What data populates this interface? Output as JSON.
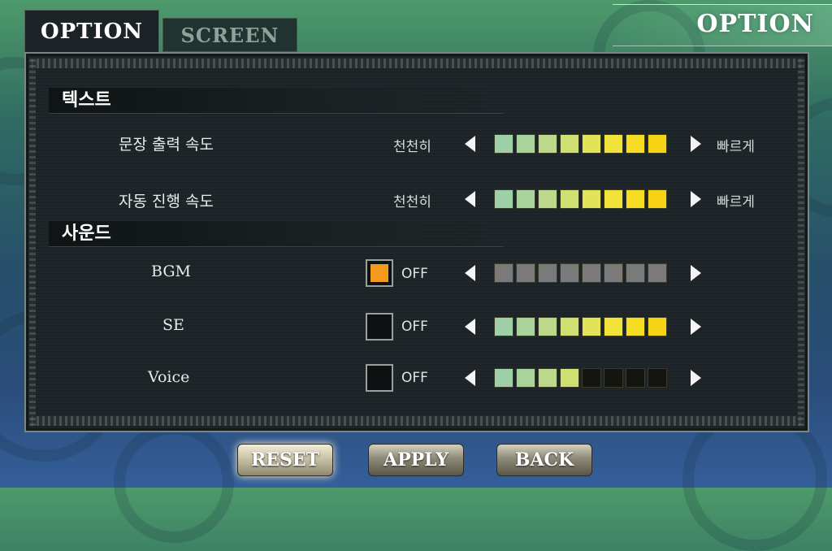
{
  "tabs": [
    {
      "label": "OPTION",
      "active": true
    },
    {
      "label": "SCREEN",
      "active": false
    }
  ],
  "page_title": "OPTION",
  "sections": {
    "text": {
      "header": "텍스트",
      "rows": [
        {
          "label": "문장 출력 속도",
          "slow": "천천히",
          "fast": "빠르게",
          "level": 8,
          "max": 8
        },
        {
          "label": "자동 진행 속도",
          "slow": "천천히",
          "fast": "빠르게",
          "level": 8,
          "max": 8
        }
      ]
    },
    "sound": {
      "header": "사운드",
      "rows": [
        {
          "label": "BGM",
          "off_label": "OFF",
          "off_checked": true,
          "level": 8,
          "max": 8
        },
        {
          "label": "SE",
          "off_label": "OFF",
          "off_checked": false,
          "level": 8,
          "max": 8
        },
        {
          "label": "Voice",
          "off_label": "OFF",
          "off_checked": false,
          "level": 4,
          "max": 8
        }
      ]
    }
  },
  "buttons": {
    "reset": "RESET",
    "apply": "APPLY",
    "back": "BACK"
  },
  "colors": {
    "segments": [
      "#9fcfa6",
      "#a9d39a",
      "#bcd98b",
      "#cfdf72",
      "#e2e357",
      "#f1e33a",
      "#f7dc24",
      "#f7d315"
    ],
    "disabled_segment": "#7a7a7a",
    "empty_segment": "#141411",
    "checkbox_on": "#f39a1c"
  }
}
